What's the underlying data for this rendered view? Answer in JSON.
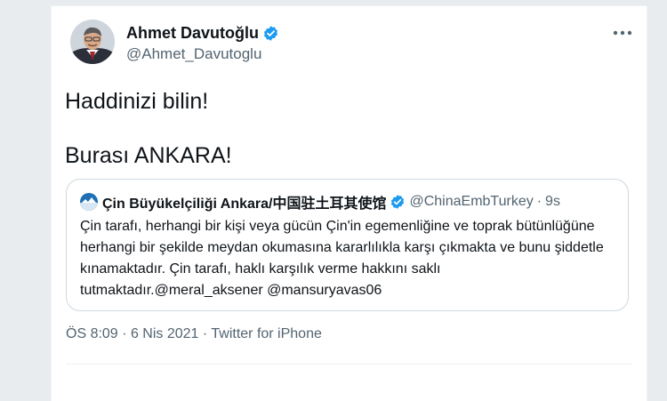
{
  "tweet": {
    "author_name": "Ahmet Davutoğlu",
    "author_handle": "@Ahmet_Davutoglu",
    "text_line1": "Haddinizi bilin!",
    "text_line2": "Burası ANKARA!",
    "timestamp_time": "ÖS 8:09",
    "timestamp_date": "6 Nis 2021",
    "separator": "·",
    "source": "Twitter for iPhone"
  },
  "quoted": {
    "author_name": "Çin Büyükelçiliği Ankara/中国驻土耳其使馆",
    "author_handle": "@ChinaEmbTurkey",
    "separator": "·",
    "time": "9s",
    "text": "Çin tarafı, herhangi bir kişi veya gücün Çin'in egemenliğine ve toprak bütünlüğüne herhangi bir şekilde meydan okumasına kararlılıkla karşı çıkmakta ve bunu şiddetle kınamaktadır. Çin tarafı, haklı karşılık verme hakkını saklı tutmaktadır.@meral_aksener @mansuryavas06"
  },
  "colors": {
    "verified_blue": "#1d9bf0",
    "secondary_text": "#536471",
    "primary_text": "#0f1419"
  },
  "icons": {
    "verified": "verified-badge-icon",
    "more": "more-options-icon"
  }
}
